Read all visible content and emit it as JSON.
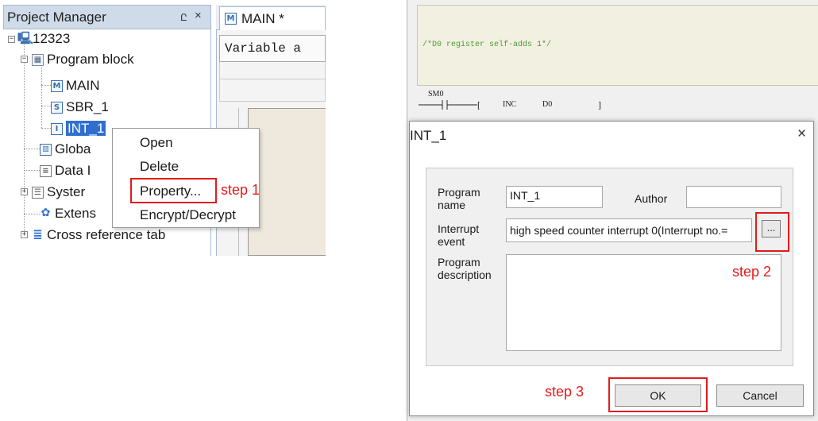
{
  "project_manager": {
    "title": "Project Manager",
    "pin_glyph": "Ը",
    "close_glyph": "×",
    "tree": [
      {
        "label": "12323",
        "icon": "computer-icon"
      },
      {
        "label": "Program block",
        "icon": "program-block-icon"
      },
      {
        "label": "MAIN",
        "icon": "main-program-icon",
        "icon_glyph": "M"
      },
      {
        "label": "SBR_1",
        "icon": "subroutine-icon",
        "icon_glyph": "S"
      },
      {
        "label": "INT_1",
        "icon": "interrupt-icon",
        "icon_glyph": "I",
        "selected": true
      },
      {
        "label": "Globa",
        "icon": "global-variables-icon"
      },
      {
        "label": "Data I",
        "icon": "data-block-icon"
      },
      {
        "label": "Syster",
        "icon": "system-block-icon"
      },
      {
        "label": "Extens",
        "icon": "extension-icon"
      },
      {
        "label": "Cross reference tab",
        "icon": "cross-reference-icon"
      }
    ]
  },
  "editor": {
    "tab_label": "MAIN *",
    "tab_icon_glyph": "M",
    "variable_header": "Variable a"
  },
  "context_menu": {
    "items": [
      "Open",
      "Delete",
      "Property...",
      "Encrypt/Decrypt"
    ]
  },
  "annotations": {
    "step1": "step 1",
    "step2": "step 2",
    "step3": "step 3",
    "highlight_color": "#e31b1b"
  },
  "ladder": {
    "comment": "/*D0 register self-adds 1*/",
    "contact": "SM0",
    "instruction": "INC",
    "operand": "D0"
  },
  "dialog": {
    "title": "INT_1",
    "close_glyph": "×",
    "program_name_label": "Program name",
    "program_name_value": "INT_1",
    "author_label": "Author",
    "author_value": "",
    "interrupt_event_label": "Interrupt event",
    "interrupt_event_value": "high speed counter interrupt 0(Interrupt no.=",
    "browse_label": "...",
    "program_description_label": "Program description",
    "program_description_value": "",
    "ok_label": "OK",
    "cancel_label": "Cancel"
  }
}
